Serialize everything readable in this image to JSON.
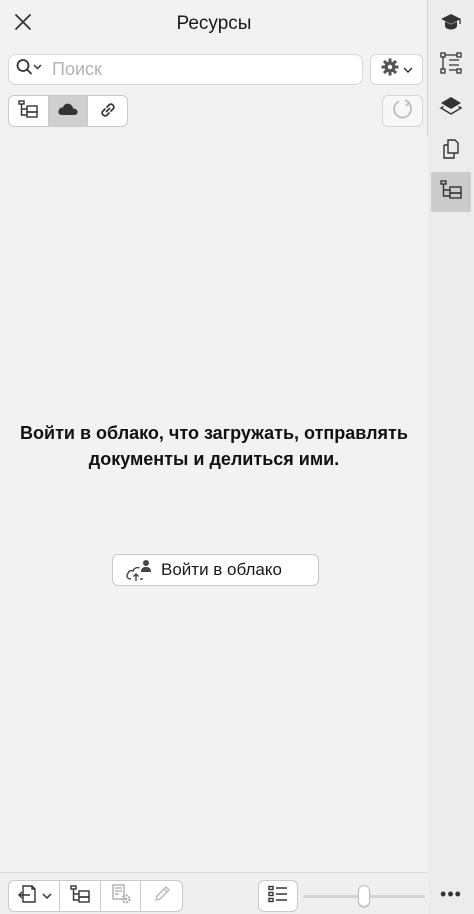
{
  "panel": {
    "title": "Ресурсы",
    "close_icon": "close-icon"
  },
  "search": {
    "placeholder": "Поиск",
    "value": "",
    "icon": "search-icon",
    "settings_icon": "gear-icon"
  },
  "view_switch": {
    "items": [
      {
        "icon": "folder-tree-icon",
        "active": false
      },
      {
        "icon": "cloud-icon",
        "active": true
      },
      {
        "icon": "link-icon",
        "active": false
      }
    ],
    "refresh_icon": "refresh-icon"
  },
  "empty_state": {
    "message": "Войти в облако, что загружать, отправлять документы и делиться ими.",
    "button_label": "Войти в облако",
    "button_icon": "cloud-upload-user-icon"
  },
  "footer": {
    "buttons": [
      {
        "icon": "import-icon",
        "has_dropdown": true
      },
      {
        "icon": "folder-tree-icon"
      },
      {
        "icon": "document-settings-icon",
        "disabled": true
      },
      {
        "icon": "pencil-icon",
        "disabled": true
      }
    ],
    "list_view_icon": "list-view-icon",
    "thumbnail_size_fraction": 0.5
  },
  "right_rail": {
    "items": [
      {
        "icon": "graduation-cap-icon",
        "active": false
      },
      {
        "icon": "tree-structure-icon",
        "active": false
      },
      {
        "icon": "layers-icon",
        "active": false
      },
      {
        "icon": "pages-icon",
        "active": false
      },
      {
        "icon": "assets-icon",
        "active": true
      }
    ],
    "more_label": "•••"
  }
}
